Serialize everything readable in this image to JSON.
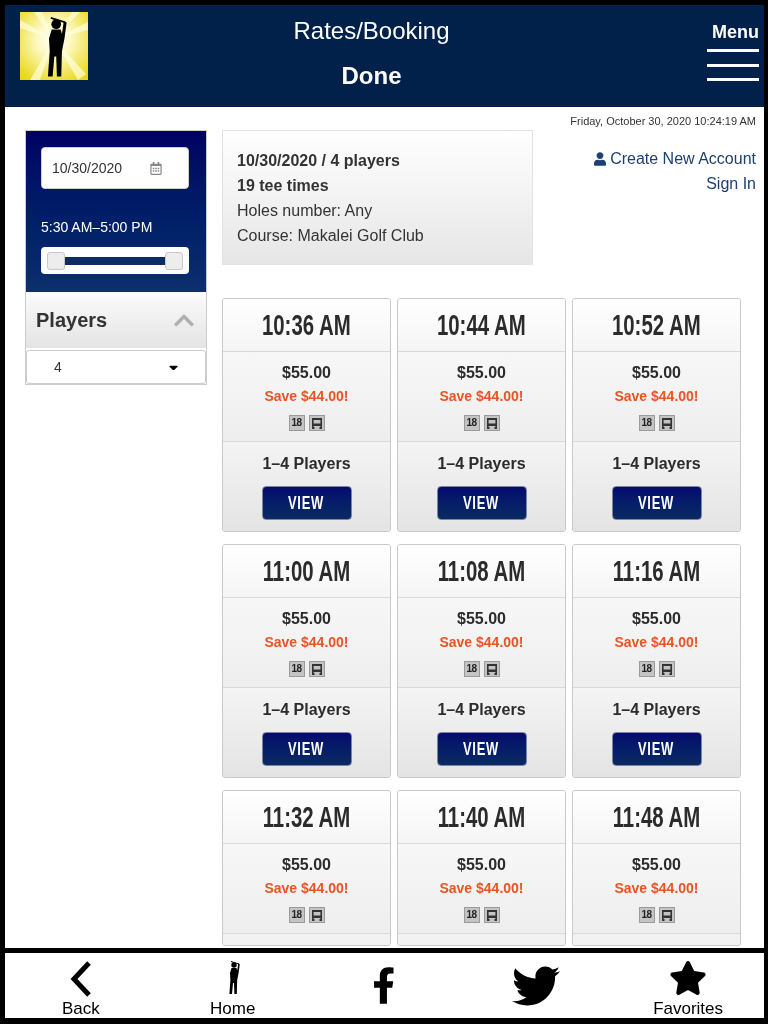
{
  "header": {
    "title": "Rates/Booking",
    "done_label": "Done",
    "menu_label": "Menu"
  },
  "timestamp": "Friday, October 30, 2020 10:24:19 AM",
  "filters": {
    "date": "10/30/2020",
    "time_range": {
      "label": "5:30 AM–5:00 PM",
      "level": 1
    },
    "players": {
      "label": "Players",
      "expanded": true,
      "value": "4"
    }
  },
  "summary": [
    {
      "text": "10/30/2020 / 4 players",
      "bold": true
    },
    {
      "text": "19 tee times",
      "bold": true
    },
    {
      "text": "Holes number: Any",
      "bold": false
    },
    {
      "text": "Course: Makalei Golf Club",
      "bold": false
    }
  ],
  "account_links": [
    {
      "kind": "create",
      "label": "Create New Account"
    },
    {
      "kind": "sign_in",
      "label": "Sign In"
    }
  ],
  "tee_times": [
    {
      "time": "10:36 AM",
      "price": "$55.00",
      "savings": "Save $44.00!",
      "holes": "18",
      "cart": true,
      "players": "1–4 Players",
      "button": "VIEW"
    },
    {
      "time": "10:44 AM",
      "price": "$55.00",
      "savings": "Save $44.00!",
      "holes": "18",
      "cart": true,
      "players": "1–4 Players",
      "button": "VIEW"
    },
    {
      "time": "10:52 AM",
      "price": "$55.00",
      "savings": "Save $44.00!",
      "holes": "18",
      "cart": true,
      "players": "1–4 Players",
      "button": "VIEW"
    },
    {
      "time": "11:00 AM",
      "price": "$55.00",
      "savings": "Save $44.00!",
      "holes": "18",
      "cart": true,
      "players": "1–4 Players",
      "button": "VIEW"
    },
    {
      "time": "11:08 AM",
      "price": "$55.00",
      "savings": "Save $44.00!",
      "holes": "18",
      "cart": true,
      "players": "1–4 Players",
      "button": "VIEW"
    },
    {
      "time": "11:16 AM",
      "price": "$55.00",
      "savings": "Save $44.00!",
      "holes": "18",
      "cart": true,
      "players": "1–4 Players",
      "button": "VIEW"
    },
    {
      "time": "11:32 AM",
      "price": "$55.00",
      "savings": "Save $44.00!",
      "holes": "18",
      "cart": true
    },
    {
      "time": "11:40 AM",
      "price": "$55.00",
      "savings": "Save $44.00!",
      "holes": "18",
      "cart": true
    },
    {
      "time": "11:48 AM",
      "price": "$55.00",
      "savings": "Save $44.00!",
      "holes": "18",
      "cart": true
    }
  ],
  "bottom_nav": [
    {
      "kind": "back",
      "label": "Back"
    },
    {
      "kind": "home",
      "label": "Home"
    },
    {
      "kind": "facebook"
    },
    {
      "kind": "twitter"
    },
    {
      "kind": "favorites",
      "label": "Favorites"
    }
  ]
}
